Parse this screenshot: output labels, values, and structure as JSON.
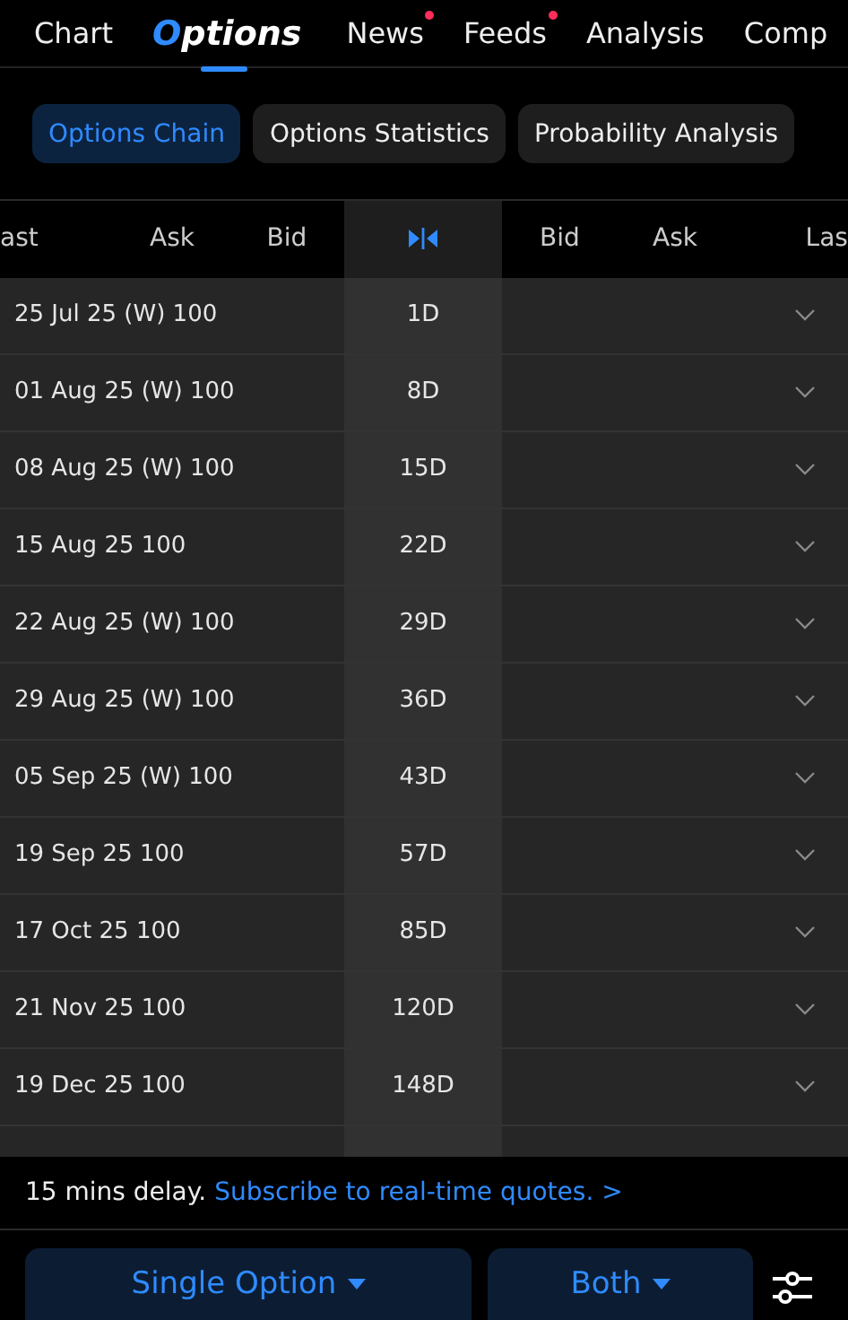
{
  "nav_tabs": [
    {
      "label": "Chart",
      "selected": false,
      "dot": false
    },
    {
      "label": "Options",
      "selected": true,
      "dot": false
    },
    {
      "label": "News",
      "selected": false,
      "dot": true
    },
    {
      "label": "Feeds",
      "selected": false,
      "dot": true
    },
    {
      "label": "Analysis",
      "selected": false,
      "dot": false
    },
    {
      "label": "Comp",
      "selected": false,
      "dot": false
    }
  ],
  "sub_tabs": [
    {
      "label": "Options Chain",
      "selected": true
    },
    {
      "label": "Options Statistics",
      "selected": false
    },
    {
      "label": "Probability Analysis",
      "selected": false
    }
  ],
  "table": {
    "left_columns": [
      "ast",
      "Ask",
      "Bid"
    ],
    "right_columns": [
      "Bid",
      "Ask",
      "Las"
    ],
    "rows": [
      {
        "expiry": "25 Jul 25 (W) 100",
        "days": "1D"
      },
      {
        "expiry": "01 Aug 25 (W) 100",
        "days": "8D"
      },
      {
        "expiry": "08 Aug 25 (W) 100",
        "days": "15D"
      },
      {
        "expiry": "15 Aug 25 100",
        "days": "22D"
      },
      {
        "expiry": "22 Aug 25 (W) 100",
        "days": "29D"
      },
      {
        "expiry": "29 Aug 25 (W) 100",
        "days": "36D"
      },
      {
        "expiry": "05 Sep 25 (W) 100",
        "days": "43D"
      },
      {
        "expiry": "19 Sep 25 100",
        "days": "57D"
      },
      {
        "expiry": "17 Oct 25 100",
        "days": "85D"
      },
      {
        "expiry": "21 Nov 25 100",
        "days": "120D"
      },
      {
        "expiry": "19 Dec 25 100",
        "days": "148D"
      }
    ]
  },
  "delay_notice": {
    "text": "15 mins delay.",
    "link": "Subscribe to real-time quotes. >"
  },
  "bottom_buttons": [
    "Single Option",
    "Both"
  ]
}
